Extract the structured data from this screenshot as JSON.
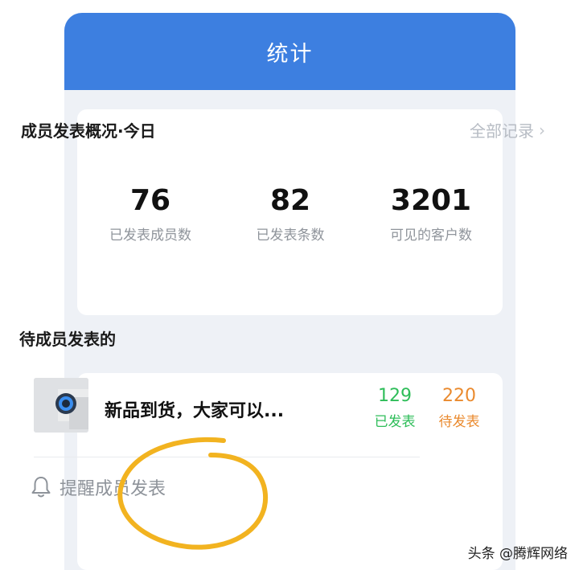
{
  "header": {
    "title": "统计"
  },
  "stats": {
    "title": "成员发表概况·今日",
    "all_records_label": "全部记录",
    "items": [
      {
        "value": "76",
        "label": "已发表成员数"
      },
      {
        "value": "82",
        "label": "已发表条数"
      },
      {
        "value": "3201",
        "label": "可见的客户数"
      }
    ]
  },
  "pending": {
    "section_title": "待成员发表的",
    "item": {
      "title": "新品到货，大家可以...",
      "published_count": "129",
      "published_label": "已发表",
      "pending_count": "220",
      "pending_label": "待发表"
    },
    "remind_label": "提醒成员发表"
  },
  "colors": {
    "header_blue": "#3d7fe0",
    "published_green": "#2ebd59",
    "pending_orange": "#ea8a2e",
    "highlight_circle": "#f2b320"
  },
  "icons": {
    "chevron": "chevron-right-icon",
    "bell": "bell-icon"
  },
  "watermark": "头条 @腾辉网络"
}
